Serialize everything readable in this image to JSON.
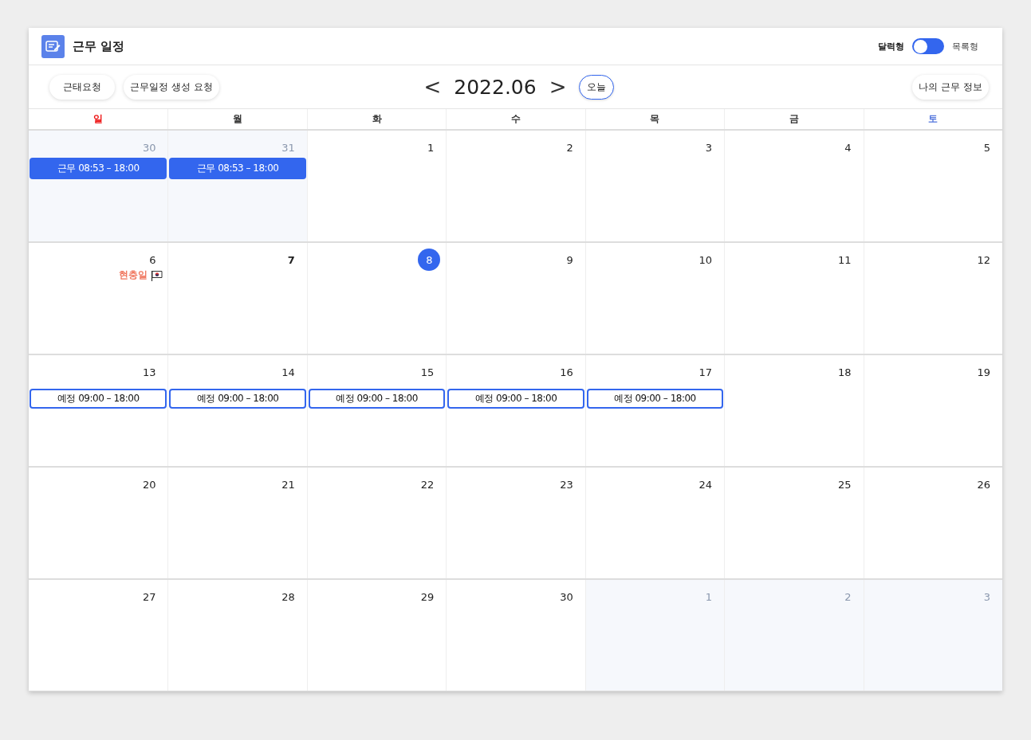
{
  "header": {
    "title": "근무 일정",
    "views": [
      {
        "label": "달력형",
        "selected": true
      },
      {
        "label": "목록형",
        "selected": false
      }
    ]
  },
  "toolbar": {
    "left_buttons": [
      "근태요청",
      "근무일정 생성 요청"
    ],
    "prev": "<",
    "month": "2022.06",
    "next": ">",
    "today_button": "오늘",
    "right_button": "나의 근무 정보"
  },
  "weekdays": [
    {
      "label": "일",
      "kind": "sunday"
    },
    {
      "label": "월",
      "kind": "weekday"
    },
    {
      "label": "화",
      "kind": "weekday"
    },
    {
      "label": "수",
      "kind": "weekday"
    },
    {
      "label": "목",
      "kind": "weekday"
    },
    {
      "label": "금",
      "kind": "weekday"
    },
    {
      "label": "토",
      "kind": "saturday"
    }
  ],
  "weeks": [
    [
      {
        "day": "30",
        "outside": true,
        "selected": false,
        "events": [
          {
            "kind": "work",
            "text": "근무 08:53 – 18:00"
          }
        ]
      },
      {
        "day": "31",
        "outside": true,
        "selected": false,
        "events": [
          {
            "kind": "work",
            "text": "근무 08:53 – 18:00"
          }
        ]
      },
      {
        "day": "1",
        "outside": false,
        "selected": false
      },
      {
        "day": "2",
        "outside": false,
        "selected": false
      },
      {
        "day": "3",
        "outside": false,
        "selected": false
      },
      {
        "day": "4",
        "outside": false,
        "selected": false
      },
      {
        "day": "5",
        "outside": false,
        "selected": false
      }
    ],
    [
      {
        "day": "6",
        "outside": false,
        "selected": false,
        "holiday": "현충일"
      },
      {
        "day": "7",
        "outside": false,
        "selected": false,
        "bold": true
      },
      {
        "day": "8",
        "outside": false,
        "selected": true
      },
      {
        "day": "9",
        "outside": false,
        "selected": false
      },
      {
        "day": "10",
        "outside": false,
        "selected": false
      },
      {
        "day": "11",
        "outside": false,
        "selected": false
      },
      {
        "day": "12",
        "outside": false,
        "selected": false
      }
    ],
    [
      {
        "day": "13",
        "outside": false,
        "selected": false,
        "events": [
          {
            "kind": "planned",
            "text": "예정 09:00 – 18:00"
          }
        ]
      },
      {
        "day": "14",
        "outside": false,
        "selected": false,
        "events": [
          {
            "kind": "planned",
            "text": "예정 09:00 – 18:00"
          }
        ]
      },
      {
        "day": "15",
        "outside": false,
        "selected": false,
        "events": [
          {
            "kind": "planned",
            "text": "예정 09:00 – 18:00"
          }
        ]
      },
      {
        "day": "16",
        "outside": false,
        "selected": false,
        "events": [
          {
            "kind": "planned",
            "text": "예정 09:00 – 18:00"
          }
        ]
      },
      {
        "day": "17",
        "outside": false,
        "selected": false,
        "events": [
          {
            "kind": "planned",
            "text": "예정 09:00 – 18:00"
          }
        ]
      },
      {
        "day": "18",
        "outside": false,
        "selected": false
      },
      {
        "day": "19",
        "outside": false,
        "selected": false
      }
    ],
    [
      {
        "day": "20",
        "outside": false,
        "selected": false
      },
      {
        "day": "21",
        "outside": false,
        "selected": false
      },
      {
        "day": "22",
        "outside": false,
        "selected": false
      },
      {
        "day": "23",
        "outside": false,
        "selected": false
      },
      {
        "day": "24",
        "outside": false,
        "selected": false
      },
      {
        "day": "25",
        "outside": false,
        "selected": false
      },
      {
        "day": "26",
        "outside": false,
        "selected": false
      }
    ],
    [
      {
        "day": "27",
        "outside": false,
        "selected": false
      },
      {
        "day": "28",
        "outside": false,
        "selected": false
      },
      {
        "day": "29",
        "outside": false,
        "selected": false
      },
      {
        "day": "30",
        "outside": false,
        "selected": false
      },
      {
        "day": "1",
        "outside": true,
        "selected": false
      },
      {
        "day": "2",
        "outside": true,
        "selected": false
      },
      {
        "day": "3",
        "outside": true,
        "selected": false
      }
    ]
  ]
}
